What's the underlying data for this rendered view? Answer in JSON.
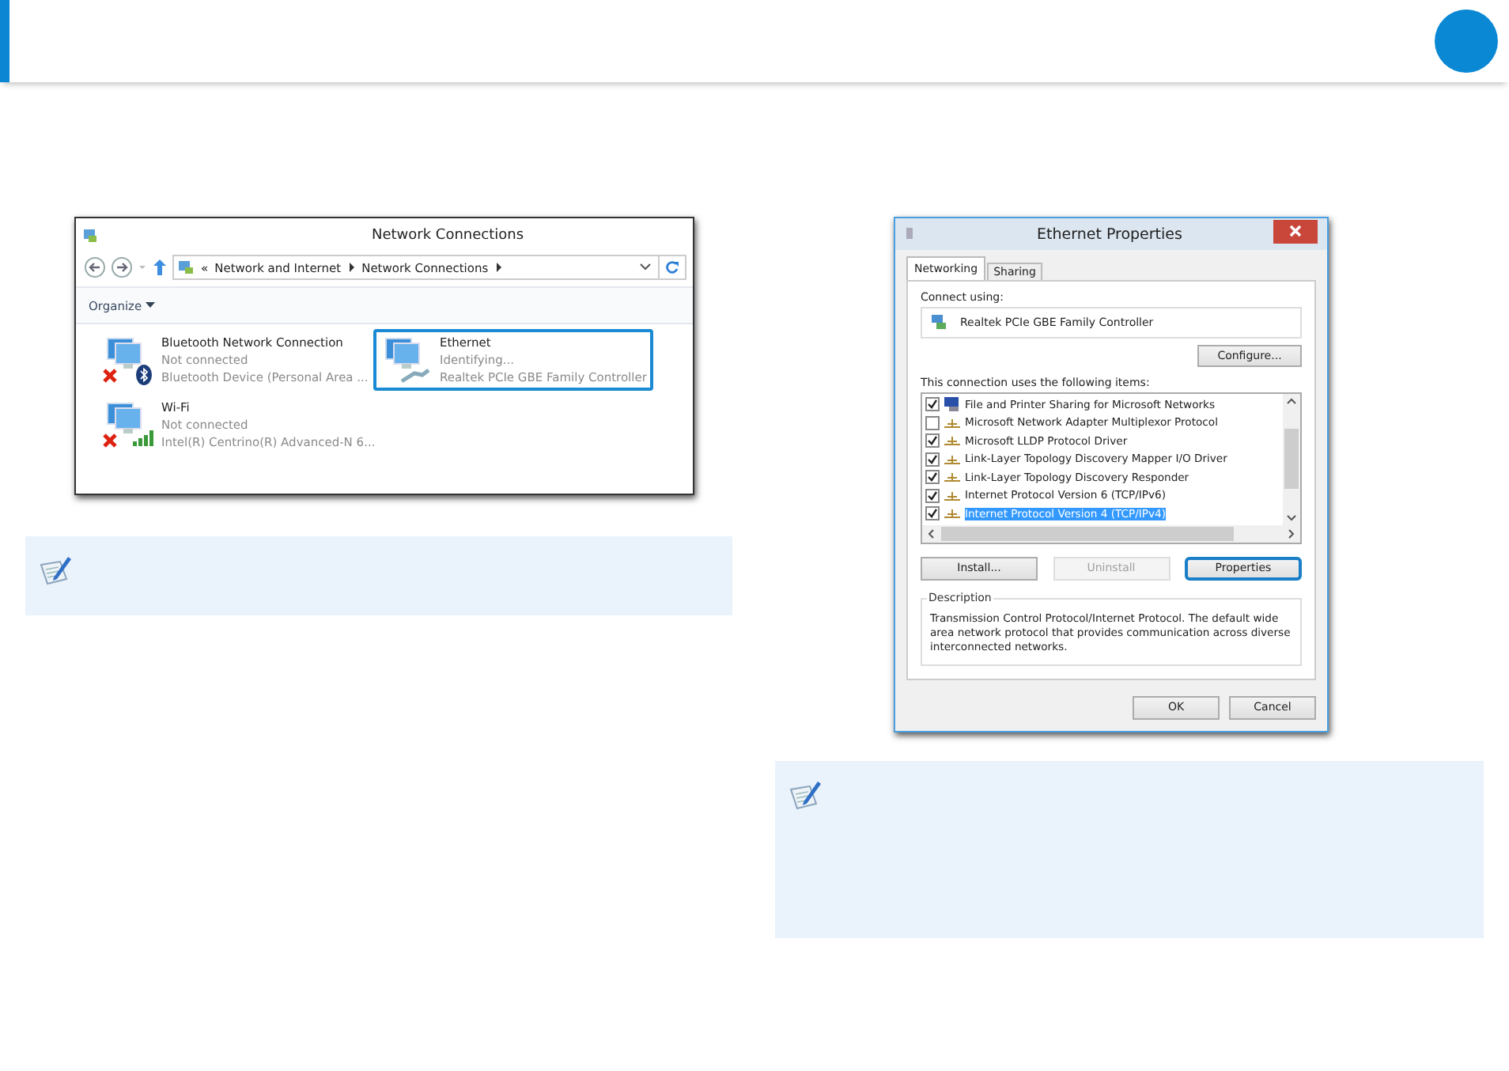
{
  "network_connections": {
    "title": "Network Connections",
    "breadcrumb": [
      "«",
      "Network and Internet",
      "Network Connections"
    ],
    "toolbar": {
      "organize": "Organize"
    },
    "connections": [
      {
        "name": "Bluetooth Network Connection",
        "status": "Not connected",
        "device": "Bluetooth Device (Personal Area ...",
        "kind": "bluetooth",
        "disconnected": true,
        "selected": false
      },
      {
        "name": "Ethernet",
        "status": "Identifying...",
        "device": "Realtek PCIe GBE Family Controller",
        "kind": "cable",
        "disconnected": false,
        "selected": true
      },
      {
        "name": "Wi-Fi",
        "status": "Not connected",
        "device": "Intel(R) Centrino(R) Advanced-N 6...",
        "kind": "signal",
        "disconnected": true,
        "selected": false
      }
    ]
  },
  "ethernet_properties": {
    "title": "Ethernet Properties",
    "tabs": [
      {
        "label": "Networking",
        "selected": true
      },
      {
        "label": "Sharing",
        "selected": false
      }
    ],
    "connect_using_label": "Connect using:",
    "adapter": "Realtek PCIe GBE Family Controller",
    "configure_button": "Configure...",
    "items_label": "This connection uses the following items:",
    "items": [
      {
        "kind": "service",
        "label": "File and Printer Sharing for Microsoft Networks",
        "checked": true,
        "selected": false
      },
      {
        "kind": "protocol",
        "label": "Microsoft Network Adapter Multiplexor Protocol",
        "checked": false,
        "selected": false
      },
      {
        "kind": "protocol",
        "label": "Microsoft LLDP Protocol Driver",
        "checked": true,
        "selected": false
      },
      {
        "kind": "protocol",
        "label": "Link-Layer Topology Discovery Mapper I/O Driver",
        "checked": true,
        "selected": false
      },
      {
        "kind": "protocol",
        "label": "Link-Layer Topology Discovery Responder",
        "checked": true,
        "selected": false
      },
      {
        "kind": "protocol",
        "label": "Internet Protocol Version 6 (TCP/IPv6)",
        "checked": true,
        "selected": false
      },
      {
        "kind": "protocol",
        "label": "Internet Protocol Version 4 (TCP/IPv4)",
        "checked": true,
        "selected": true
      }
    ],
    "action_buttons": [
      {
        "label": "Install...",
        "disabled": false,
        "highlighted": false
      },
      {
        "label": "Uninstall",
        "disabled": true,
        "highlighted": false
      },
      {
        "label": "Properties",
        "disabled": false,
        "highlighted": true
      }
    ],
    "description_label": "Description",
    "description": "Transmission Control Protocol/Internet Protocol. The default wide area network protocol that provides communication across diverse interconnected networks.",
    "dialog_buttons": [
      "OK",
      "Cancel"
    ]
  }
}
